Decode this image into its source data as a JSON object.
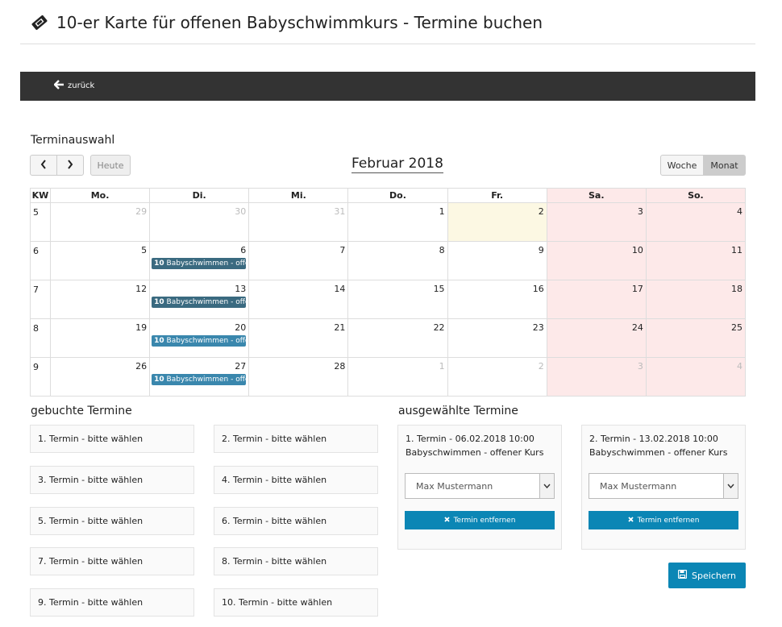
{
  "header": {
    "title": "10-er Karte für offenen Babyschwimmkurs - Termine buchen",
    "title_icon": "ticket-icon",
    "back_label": "zurück"
  },
  "calendar": {
    "section_label": "Terminauswahl",
    "today_label": "Heute",
    "month_label": "Februar 2018",
    "view_week": "Woche",
    "view_month": "Monat",
    "active_view": "Monat",
    "columns": [
      "KW",
      "Mo.",
      "Di.",
      "Mi.",
      "Do.",
      "Fr.",
      "Sa.",
      "So."
    ],
    "weeks": [
      {
        "kw": "5",
        "days": [
          {
            "n": "29",
            "other": true
          },
          {
            "n": "30",
            "other": true
          },
          {
            "n": "31",
            "other": true
          },
          {
            "n": "1"
          },
          {
            "n": "2",
            "today": true
          },
          {
            "n": "3"
          },
          {
            "n": "4"
          }
        ]
      },
      {
        "kw": "6",
        "days": [
          {
            "n": "5"
          },
          {
            "n": "6",
            "event": {
              "count": "10",
              "label": "Babyschwimmen - offener Kurs",
              "color": "#3a6a80"
            }
          },
          {
            "n": "7"
          },
          {
            "n": "8"
          },
          {
            "n": "9"
          },
          {
            "n": "10"
          },
          {
            "n": "11"
          }
        ]
      },
      {
        "kw": "7",
        "days": [
          {
            "n": "12"
          },
          {
            "n": "13",
            "event": {
              "count": "10",
              "label": "Babyschwimmen - offener Kurs",
              "color": "#3a6a80"
            }
          },
          {
            "n": "14"
          },
          {
            "n": "15"
          },
          {
            "n": "16"
          },
          {
            "n": "17"
          },
          {
            "n": "18"
          }
        ]
      },
      {
        "kw": "8",
        "days": [
          {
            "n": "19"
          },
          {
            "n": "20",
            "event": {
              "count": "10",
              "label": "Babyschwimmen - offener Kurs",
              "color": "#3a87ad"
            }
          },
          {
            "n": "21"
          },
          {
            "n": "22"
          },
          {
            "n": "23"
          },
          {
            "n": "24"
          },
          {
            "n": "25"
          }
        ]
      },
      {
        "kw": "9",
        "days": [
          {
            "n": "26"
          },
          {
            "n": "27",
            "event": {
              "count": "10",
              "label": "Babyschwimmen - offener Kurs",
              "color": "#3a87ad"
            }
          },
          {
            "n": "28"
          },
          {
            "n": "1",
            "other": true
          },
          {
            "n": "2",
            "other": true
          },
          {
            "n": "3",
            "other": true
          },
          {
            "n": "4",
            "other": true
          }
        ]
      }
    ]
  },
  "booked": {
    "section_label": "gebuchte Termine",
    "slots": [
      "1. Termin - bitte wählen",
      "2. Termin - bitte wählen",
      "3. Termin - bitte wählen",
      "4. Termin - bitte wählen",
      "5. Termin - bitte wählen",
      "6. Termin - bitte wählen",
      "7. Termin - bitte wählen",
      "8. Termin - bitte wählen",
      "9. Termin - bitte wählen",
      "10. Termin - bitte wählen"
    ]
  },
  "selected": {
    "section_label": "ausgewählte Termine",
    "items": [
      {
        "line1": "1. Termin - 06.02.2018 10:00",
        "line2": "Babyschwimmen - offener Kurs",
        "person": "Max Mustermann",
        "remove_label": "Termin entfernen"
      },
      {
        "line1": "2. Termin - 13.02.2018 10:00",
        "line2": "Babyschwimmen - offener Kurs",
        "person": "Max Mustermann",
        "remove_label": "Termin entfernen"
      }
    ]
  },
  "save_label": "Speichern",
  "colors": {
    "accent": "#0b86b5",
    "topbar": "#333333",
    "weekend": "#fde9e9",
    "today": "#fcf8e3"
  }
}
